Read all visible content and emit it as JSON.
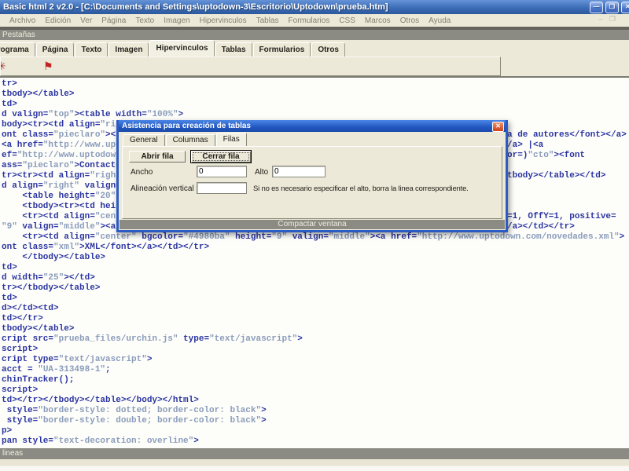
{
  "window": {
    "title": "Basic html 2 v2.0 - [C:\\Documents and Settings\\uptodown-3\\Escritorio\\Uptodown\\prueba.htm]",
    "controls": {
      "minimize": "—",
      "restore": "❐",
      "close": "✕"
    }
  },
  "menu": {
    "items": [
      "Archivo",
      "Edición",
      "Ver",
      "Página",
      "Texto",
      "Imagen",
      "Hipervinculos",
      "Tablas",
      "Formularios",
      "CSS",
      "Marcos",
      "Otros",
      "Ayuda"
    ]
  },
  "toolbar_caption": "Pestañas",
  "tabs": {
    "items": [
      "Programa",
      "Página",
      "Texto",
      "Imagen",
      "Hipervinculos",
      "Tablas",
      "Formularios",
      "Otros"
    ],
    "active": "Hipervinculos"
  },
  "toolbar_icons": [
    {
      "name": "anchor-icon",
      "glyph": "✳",
      "color": "#a83434"
    },
    {
      "name": "flag-icon",
      "glyph": "⚑",
      "color": "#c22222"
    }
  ],
  "editor": {
    "lines": [
      "tr>",
      "tbody></table>",
      "td>",
      "d valign=\"top\"><table width=\"100%\">",
      "body><tr><td align=\"rig",
      {
        "text": "ont class=\"pieclaro\"><a",
        "right": "a de autores</font></a>"
      },
      {
        "text": "<a href=\"http://www.upt",
        "right": "/a> |<a"
      },
      {
        "text": "ef=\"http://www.uptodown",
        "right": "or=)\"cto\"><font"
      },
      "ass=\"pieclaro\">Contacte",
      {
        "text": "tr><tr><td align=\"right",
        "right": "tbody></table></td>"
      },
      "d align=\"right\" valign=",
      "    <table height=\"20\"",
      "    <tbody><tr><td heig",
      {
        "text": "    <tr><td align=\"cent",
        "right": "=1, OffY=1, positive="
      },
      {
        "text": "\"9\" valign=\"middle\"><a ",
        "right": "/a></td></tr>"
      },
      "    <tr><td align=\"center\" bgcolor=\"#4980ba\" height=\"9\" valign=\"middle\"><a href=\"http://www.uptodown.com/novedades.xml\">",
      "ont class=\"xml\">XML</font></a></td></tr>",
      "    </tbody></table>",
      "td>",
      "d width=\"25\"></td>",
      "tr></tbody></table>",
      "td>",
      "d></td><td>",
      "td></tr>",
      "tbody></table>",
      "cript src=\"prueba_files/urchin.js\" type=\"text/javascript\">",
      "script>",
      "cript type=\"text/javascript\">",
      "acct = \"UA-313498-1\";",
      "chinTracker();",
      "script>",
      "td></tr></tbody></table></body></html>",
      " style=\"border-style: dotted; border-color: black\">",
      " style=\"border-style: double; border-color: black\">",
      "p>",
      "pan style=\"text-decoration: overline\">"
    ]
  },
  "dialog": {
    "title": "Asistencia para creación de tablas",
    "close_glyph": "✕",
    "tabs": [
      "General",
      "Columnas",
      "Filas"
    ],
    "active_tab": "Filas",
    "buttons": {
      "open_row": "Abrir fila",
      "close_row": "Cerrar fila"
    },
    "fields": {
      "width_label": "Ancho",
      "width_value": "0",
      "height_label": "Alto",
      "height_value": "0",
      "valign_label": "Alineación vertical",
      "valign_value": ""
    },
    "hint": "Si no es necesario especificar el alto, borra la linea correspondiente.",
    "footer": "Compactar ventana"
  },
  "statusbar": {
    "text": "lineas"
  },
  "colors": {
    "chrome_beige": "#ece9d8",
    "gray_bar": "#8b8b83",
    "titlebar_blue": "#3c6db6",
    "dialog_frame_blue": "#2b5bc4",
    "code_tag": "#2b35a0",
    "code_value": "#8a9cba",
    "link_bgcolor_in_code": "#4980ba"
  }
}
